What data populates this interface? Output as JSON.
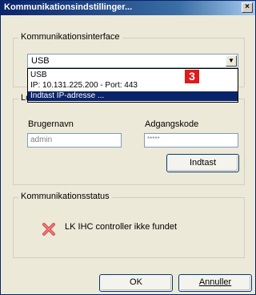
{
  "window": {
    "title": "Kommunikationsindstillinger...",
    "close_glyph": "×"
  },
  "interface_group": {
    "legend": "Kommunikationsinterface",
    "selected_value": "USB",
    "dropdown_arrow": "▼",
    "options": [
      "USB",
      "IP: 10.131.225.200 - Port: 443",
      "Indtast IP-adresse ..."
    ],
    "highlighted_option": "Indtast IP-adresse ...",
    "annotation_badge": "3"
  },
  "login_group": {
    "legend_partial": "Lo",
    "username_label": "Brugernavn",
    "username_value": "admin",
    "password_label": "Adgangskode",
    "password_value": "*****",
    "submit_label": "Indtast"
  },
  "status_group": {
    "legend": "Kommunikationsstatus",
    "icon": "red-x-error-icon",
    "message": "LK IHC controller ikke fundet"
  },
  "footer": {
    "ok_label": "OK",
    "cancel_label": "Annuller"
  },
  "colors": {
    "title_gradient_start": "#0a246a",
    "dialog_bg": "#ece9d8",
    "selection": "#0a246a",
    "badge": "#e01a1a",
    "error_icon": "#e04040"
  }
}
